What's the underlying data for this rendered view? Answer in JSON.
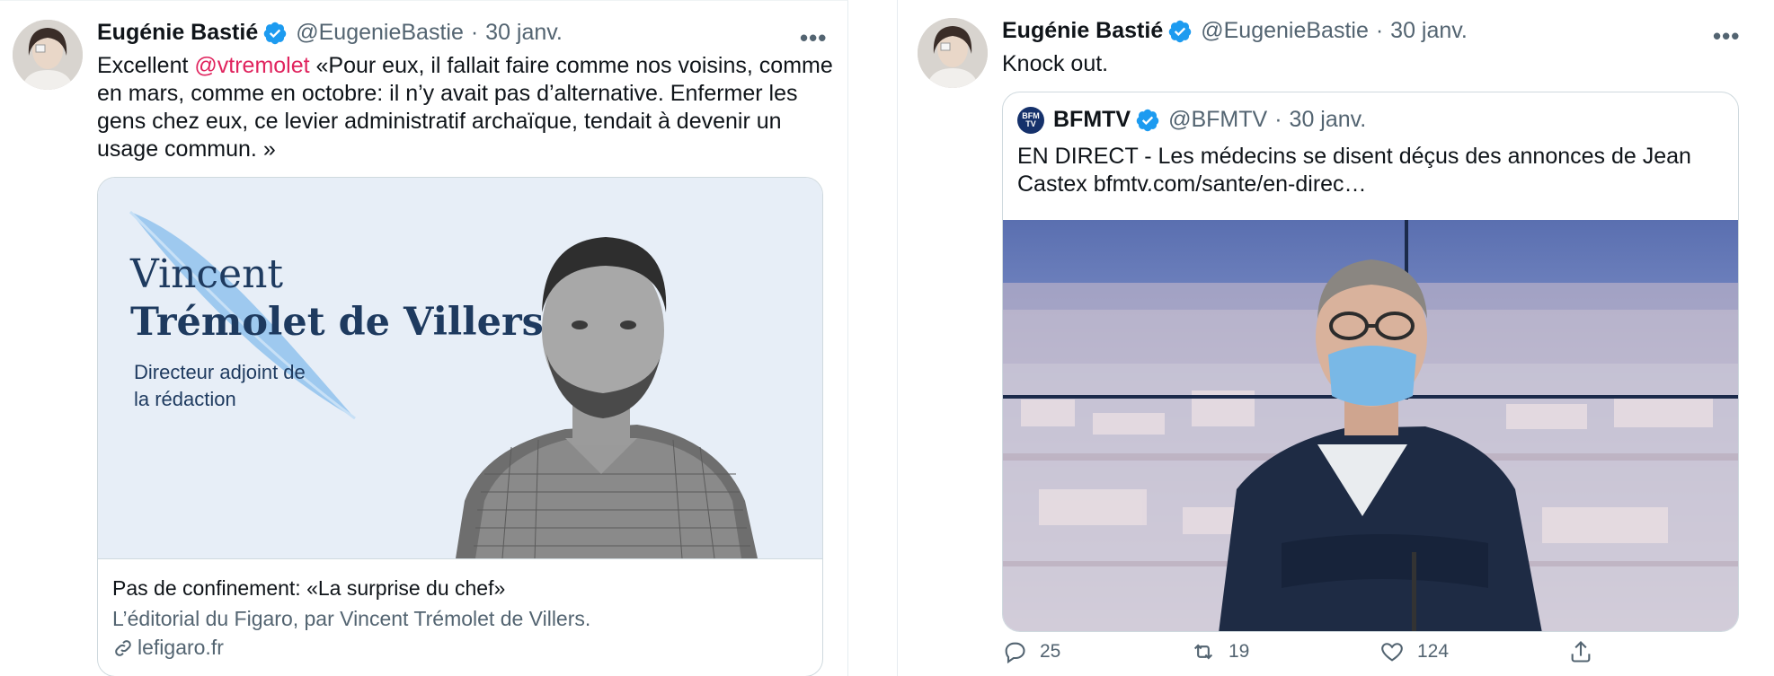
{
  "left_tweet": {
    "author_name": "Eugénie Bastié",
    "handle": "@EugenieBastie",
    "separator": "·",
    "date": "30 janv.",
    "more_label": "•••",
    "text_prefix": "Excellent ",
    "mention": "@vtremolet",
    "text_rest": " «Pour eux, il fallait faire comme nos voisins, comme en mars, comme en octobre: il n’y avait pas d’alternative. Enfermer les gens chez eux, ce levier administratif archaïque, tendait à devenir un usage commun. »",
    "card": {
      "image_name_line1": "Vincent",
      "image_name_line2": "Trémolet de Villers",
      "image_role_line1": "Directeur adjoint de",
      "image_role_line2": "la rédaction",
      "title": "Pas de confinement: «La surprise du chef»",
      "description": "L’éditorial du Figaro, par Vincent Trémolet de Villers.",
      "domain": "lefigaro.fr"
    }
  },
  "right_tweet": {
    "author_name": "Eugénie Bastié",
    "handle": "@EugenieBastie",
    "separator": "·",
    "date": "30 janv.",
    "more_label": "•••",
    "text": "Knock out.",
    "quote": {
      "avatar_text": "BFM TV",
      "author_name": "BFMTV",
      "handle": "@BFMTV",
      "separator": "·",
      "date": "30 janv.",
      "text": "EN DIRECT - Les médecins se disent déçus des annonces de Jean Castex bfmtv.com/sante/en-direc…"
    },
    "actions": {
      "reply_count": "25",
      "retweet_count": "19",
      "like_count": "124"
    }
  },
  "colors": {
    "verified": "#1d9bf0",
    "mention": "#e0245e",
    "secondary_text": "#536471",
    "border": "#cfd9de"
  }
}
